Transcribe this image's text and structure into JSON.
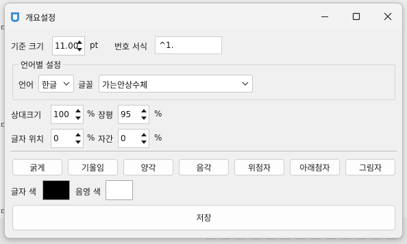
{
  "window": {
    "title": "개요설정"
  },
  "font_size": {
    "label": "기준 크기",
    "value": "11.00",
    "unit": "pt"
  },
  "numbering": {
    "label": "번호 서식",
    "value": "^1."
  },
  "language_group": {
    "title": "언어별 설정",
    "language_label": "언어",
    "language_value": "한글",
    "font_label": "글꼴",
    "font_value": "가는안상수체"
  },
  "relative_size": {
    "label": "상대크기",
    "value": "100",
    "unit": "%"
  },
  "width_ratio": {
    "label": "장평",
    "value": "95",
    "unit": "%"
  },
  "char_position": {
    "label": "글자 위치",
    "value": "0",
    "unit": "%"
  },
  "spacing": {
    "label": "자간",
    "value": "0",
    "unit": "%"
  },
  "style_buttons": [
    "굵게",
    "기울임",
    "양각",
    "음각",
    "위첨자",
    "아래첨자",
    "그림자"
  ],
  "colors": {
    "text_color_label": "글자 색",
    "text_color": "#000000",
    "shade_color_label": "음영 색",
    "shade_color": "#ffffff"
  },
  "save_button": "저장"
}
